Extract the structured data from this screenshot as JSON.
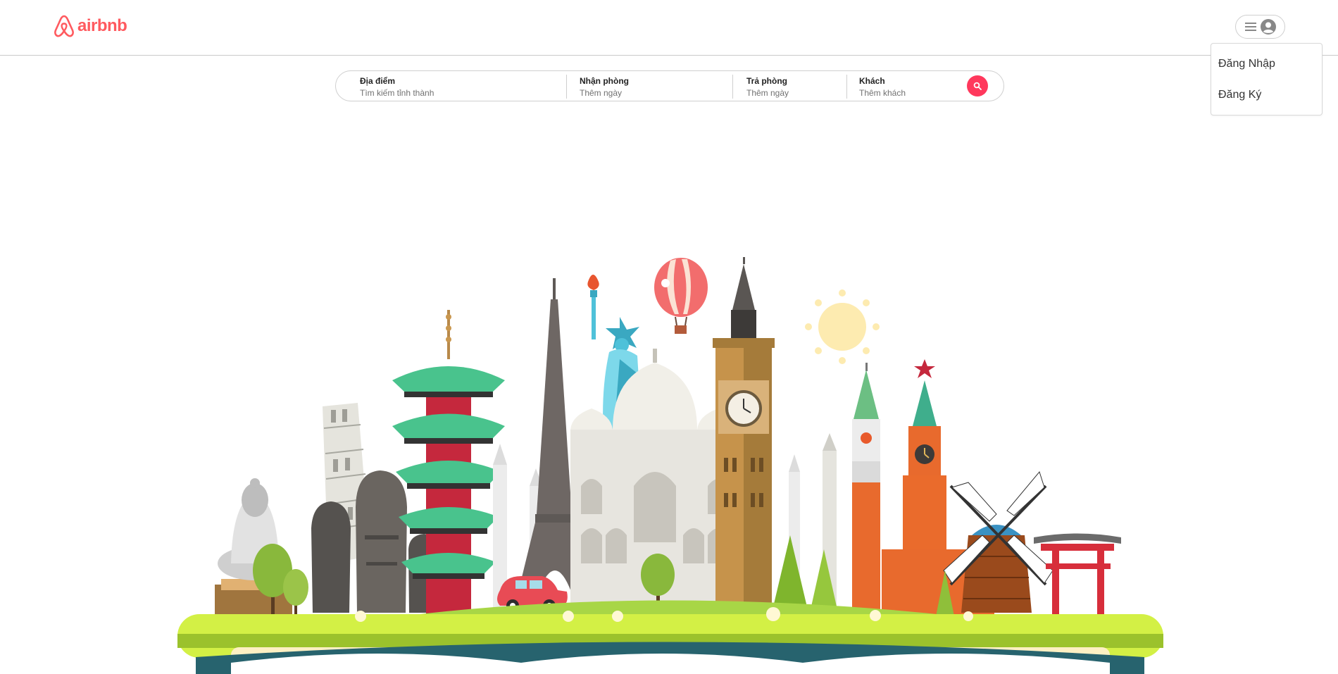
{
  "brand": {
    "name": "airbnb",
    "color": "#ff5a5f",
    "icon": "airbnb-logo-icon"
  },
  "user_menu": {
    "icons": [
      "hamburger-icon",
      "user-avatar-icon"
    ],
    "items": [
      "Đăng Nhập",
      "Đăng Ký"
    ]
  },
  "search": {
    "location": {
      "label": "Địa điểm",
      "placeholder": "Tìm kiếm tỉnh thành"
    },
    "check_in": {
      "label": "Nhận phòng",
      "placeholder": "Thêm ngày"
    },
    "check_out": {
      "label": "Trả phòng",
      "placeholder": "Thêm ngày"
    },
    "guests": {
      "label": "Khách",
      "placeholder": "Thêm khách"
    },
    "button_icon": "search-icon",
    "button_color": "#ff385c"
  },
  "hero": {
    "illustration": "world-landmarks-illustration"
  }
}
